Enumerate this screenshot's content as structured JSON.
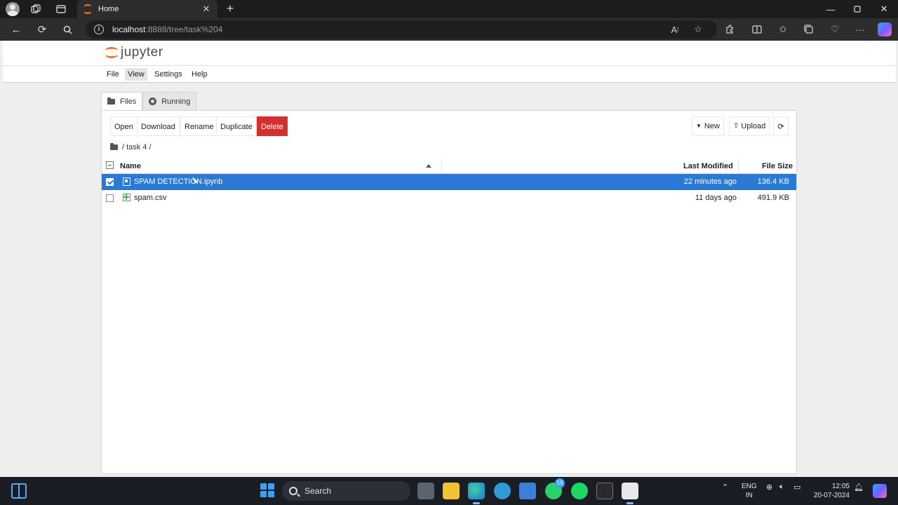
{
  "browser": {
    "tab_title": "Home",
    "url_host": "localhost",
    "url_path": ":8888/tree/task%204"
  },
  "jupyter": {
    "logo_text": "jupyter",
    "menu": [
      "File",
      "View",
      "Settings",
      "Help"
    ],
    "tabs": {
      "files": "Files",
      "running": "Running"
    },
    "actions": {
      "open": "Open",
      "download": "Download",
      "rename": "Rename",
      "duplicate": "Duplicate",
      "delete": "Delete",
      "new": "New",
      "upload": "Upload"
    },
    "breadcrumb": "/ task 4 /",
    "columns": {
      "name": "Name",
      "modified": "Last Modified",
      "size": "File Size"
    },
    "files": [
      {
        "name": "SPAM DETECTION.ipynb",
        "modified": "22 minutes ago",
        "size": "136.4 KB",
        "icon": "notebook-icon",
        "selected": true
      },
      {
        "name": "spam.csv",
        "modified": "11 days ago",
        "size": "491.9 KB",
        "icon": "spreadsheet-icon",
        "selected": false
      }
    ]
  },
  "taskbar": {
    "search_label": "Search",
    "whatsapp_badge": "19",
    "lang_line1": "ENG",
    "lang_line2": "IN",
    "time": "12:05",
    "date": "20-07-2024"
  },
  "colors": {
    "jupyter_orange": "#f37726",
    "selection_blue": "#2a7ad5",
    "delete_red": "#d32f2f"
  }
}
